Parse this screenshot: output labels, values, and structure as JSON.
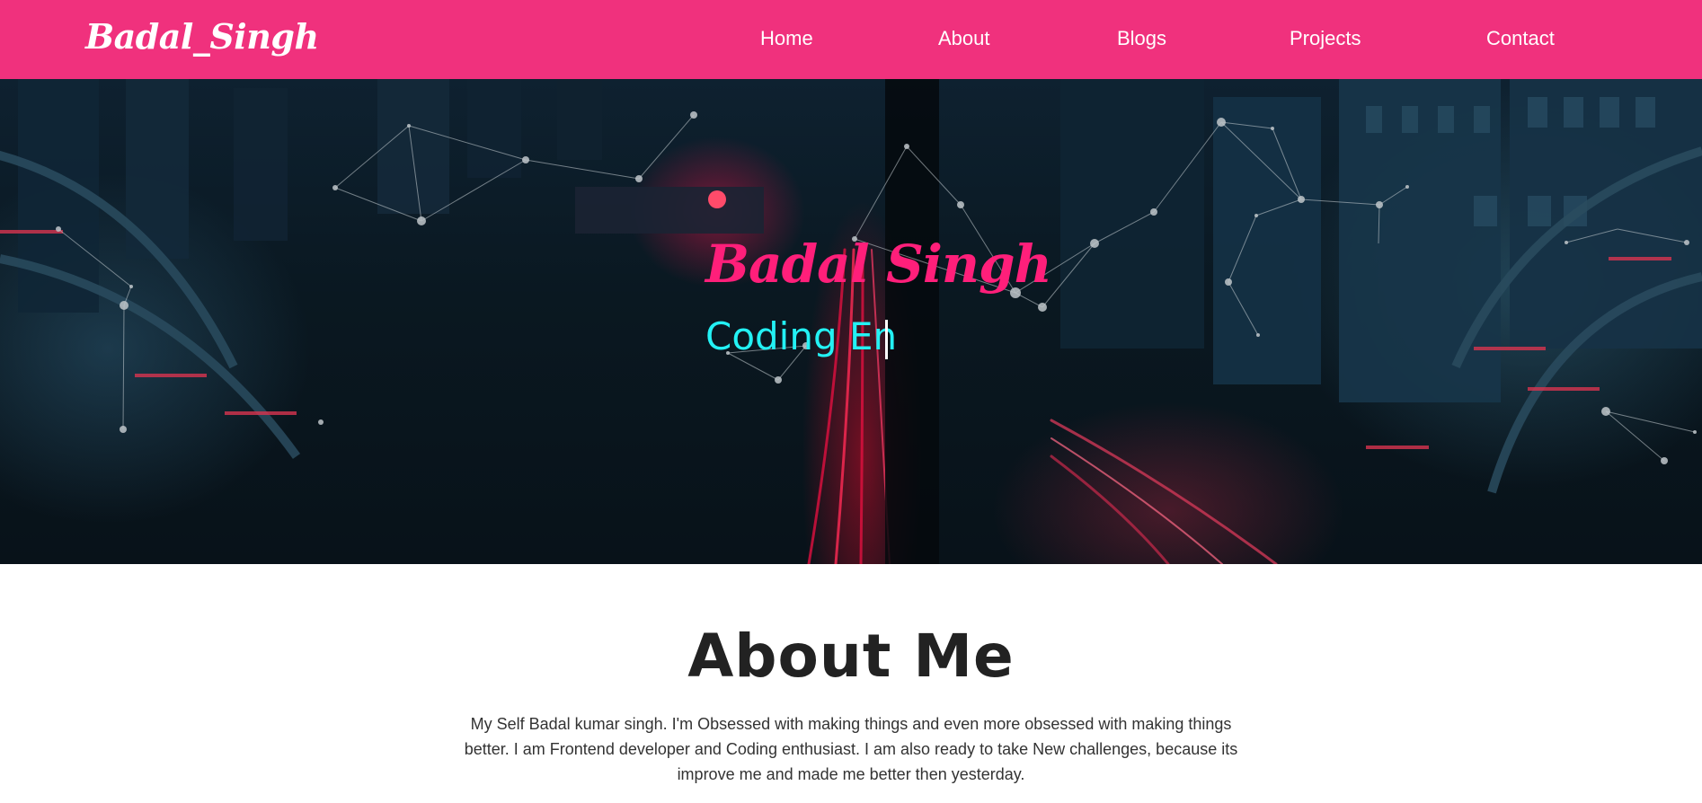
{
  "navbar": {
    "brand": "Badal_Singh",
    "links": [
      "Home",
      "About",
      "Blogs",
      "Projects",
      "Contact"
    ],
    "background": "#f0317d"
  },
  "hero": {
    "name": "Badal Singh",
    "typed_text": "Coding En",
    "name_color": "#ff1f7a",
    "typed_color": "#23f1f4"
  },
  "about": {
    "title": "About Me",
    "text": "My Self Badal kumar singh. I'm Obsessed with making things and even more obsessed with making things better. I am Frontend developer and Coding enthusiast. I am also ready to take New challenges, because its improve me and made me better then yesterday."
  }
}
